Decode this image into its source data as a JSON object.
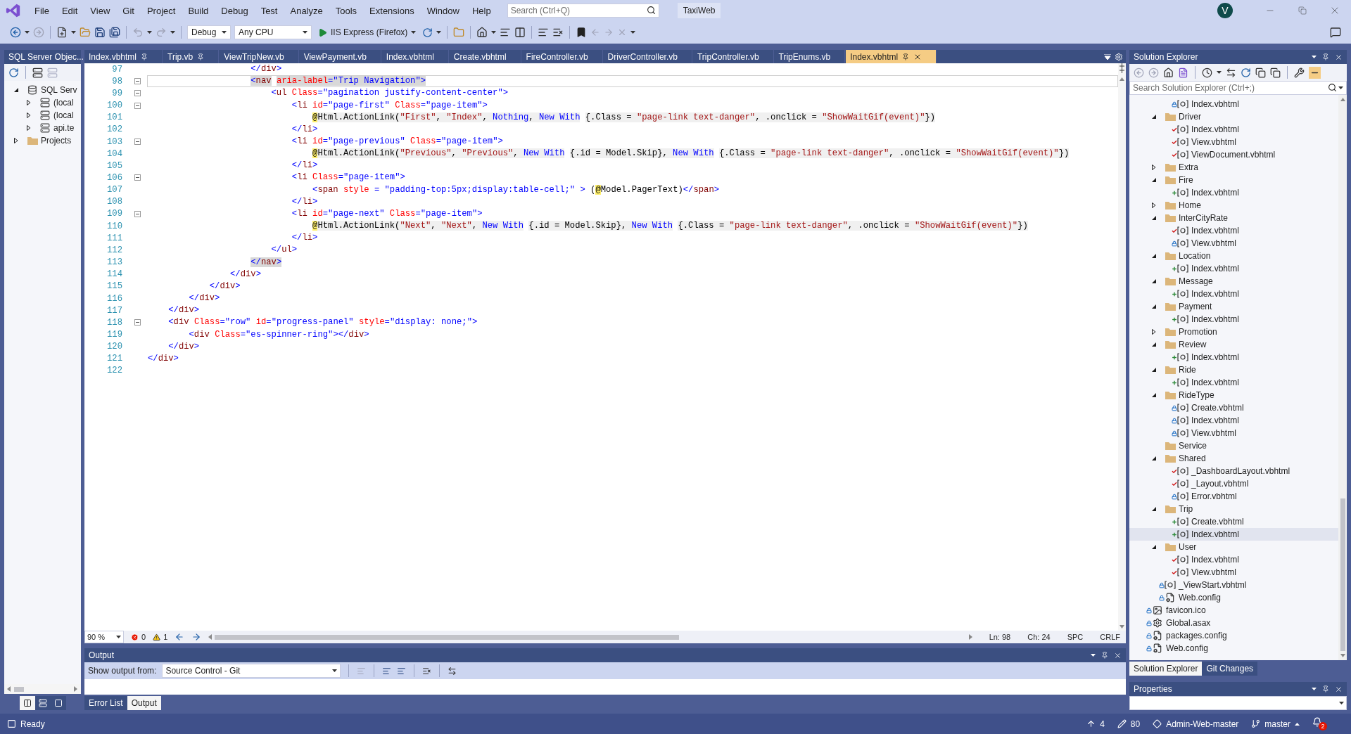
{
  "menu": [
    "File",
    "Edit",
    "View",
    "Git",
    "Project",
    "Build",
    "Debug",
    "Test",
    "Analyze",
    "Tools",
    "Extensions",
    "Window",
    "Help"
  ],
  "search": {
    "placeholder": "Search (Ctrl+Q)"
  },
  "solution_name": "TaxiWeb",
  "account": {
    "initial": "V"
  },
  "toolbar": {
    "configuration": "Debug",
    "platform": "Any CPU",
    "run_target": "IIS Express (Firefox)"
  },
  "sql_explorer": {
    "title": "SQL Server Objec...",
    "tree": [
      {
        "label": "SQL Serv",
        "kind": "server-group",
        "expanded": true,
        "children": [
          {
            "label": "(local",
            "kind": "server",
            "expanded": false
          },
          {
            "label": "(local",
            "kind": "server",
            "expanded": false
          },
          {
            "label": "api.te",
            "kind": "server",
            "expanded": false
          }
        ]
      },
      {
        "label": "Projects",
        "kind": "folder",
        "expanded": false
      }
    ],
    "view_buttons": [
      {
        "selected": true
      },
      {
        "selected": false
      },
      {
        "selected": false
      }
    ]
  },
  "editor": {
    "tabs": [
      {
        "label": "Index.vbhtml",
        "pinned": true,
        "selected": false
      },
      {
        "label": "Trip.vb",
        "pinned": true,
        "selected": false
      },
      {
        "label": "ViewTripNew.vb",
        "pinned": false,
        "selected": false
      },
      {
        "label": "ViewPayment.vb",
        "pinned": false,
        "selected": false
      },
      {
        "label": "Index.vbhtml",
        "pinned": false,
        "selected": false
      },
      {
        "label": "Create.vbhtml",
        "pinned": false,
        "selected": false
      },
      {
        "label": "FireController.vb",
        "pinned": false,
        "selected": false
      },
      {
        "label": "DriverController.vb",
        "pinned": false,
        "selected": false
      },
      {
        "label": "TripController.vb",
        "pinned": false,
        "selected": false
      },
      {
        "label": "TripEnums.vb",
        "pinned": false,
        "selected": false
      },
      {
        "label": "Index.vbhtml",
        "pinned": true,
        "selected": true
      }
    ],
    "lines": [
      {
        "number": "97",
        "kind": "markup",
        "current": false,
        "match": false,
        "foldable": false,
        "tokens": [
          {
            "kind": "delim",
            "text": "                    </"
          },
          {
            "kind": "tag",
            "text": "div"
          },
          {
            "kind": "delim",
            "text": ">"
          }
        ]
      },
      {
        "number": "98",
        "kind": "markup",
        "current": true,
        "match": true,
        "foldable": true,
        "tokens": [
          {
            "kind": "delim",
            "text": "                    <"
          },
          {
            "kind": "tag",
            "text": "nav"
          },
          {
            "kind": "attr",
            "text": " aria-label"
          },
          {
            "kind": "delim",
            "text": "="
          },
          {
            "kind": "value",
            "text": "\"Trip Navigation\""
          },
          {
            "kind": "delim",
            "text": ">"
          }
        ]
      },
      {
        "number": "99",
        "kind": "markup",
        "current": false,
        "match": false,
        "foldable": true,
        "tokens": [
          {
            "kind": "delim",
            "text": "                        <"
          },
          {
            "kind": "tag",
            "text": "ul"
          },
          {
            "kind": "attr",
            "text": " Class"
          },
          {
            "kind": "delim",
            "text": "="
          },
          {
            "kind": "value",
            "text": "\"pagination justify-content-center\""
          },
          {
            "kind": "delim",
            "text": ">"
          }
        ]
      },
      {
        "number": "100",
        "kind": "markup",
        "current": false,
        "match": false,
        "foldable": true,
        "tokens": [
          {
            "kind": "delim",
            "text": "                            <"
          },
          {
            "kind": "tag",
            "text": "li"
          },
          {
            "kind": "attr",
            "text": " id"
          },
          {
            "kind": "delim",
            "text": "="
          },
          {
            "kind": "value",
            "text": "\"page-first\""
          },
          {
            "kind": "attr",
            "text": " Class"
          },
          {
            "kind": "delim",
            "text": "="
          },
          {
            "kind": "value",
            "text": "\"page-item\""
          },
          {
            "kind": "delim",
            "text": ">"
          }
        ]
      },
      {
        "number": "101",
        "kind": "razor",
        "current": false,
        "match": false,
        "foldable": false,
        "tokens": [
          {
            "kind": "at",
            "text": "                                @"
          },
          {
            "kind": "code",
            "text": "Html.ActionLink("
          },
          {
            "kind": "string",
            "text": "\"First\""
          },
          {
            "kind": "code",
            "text": ", "
          },
          {
            "kind": "string",
            "text": "\"Index\""
          },
          {
            "kind": "code",
            "text": ", "
          },
          {
            "kind": "keyword",
            "text": "Nothing"
          },
          {
            "kind": "code",
            "text": ", "
          },
          {
            "kind": "keyword",
            "text": "New With"
          },
          {
            "kind": "code",
            "text": " {.Class = "
          },
          {
            "kind": "string",
            "text": "\"page-link text-danger\""
          },
          {
            "kind": "code",
            "text": ", .onclick = "
          },
          {
            "kind": "string",
            "text": "\"ShowWaitGif(event)\""
          },
          {
            "kind": "code",
            "text": "})"
          }
        ]
      },
      {
        "number": "102",
        "kind": "markup",
        "current": false,
        "match": false,
        "foldable": false,
        "tokens": [
          {
            "kind": "delim",
            "text": "                            </"
          },
          {
            "kind": "tag",
            "text": "li"
          },
          {
            "kind": "delim",
            "text": ">"
          }
        ]
      },
      {
        "number": "103",
        "kind": "markup",
        "current": false,
        "match": false,
        "foldable": true,
        "tokens": [
          {
            "kind": "delim",
            "text": "                            <"
          },
          {
            "kind": "tag",
            "text": "li"
          },
          {
            "kind": "attr",
            "text": " id"
          },
          {
            "kind": "delim",
            "text": "="
          },
          {
            "kind": "value",
            "text": "\"page-previous\""
          },
          {
            "kind": "attr",
            "text": " Class"
          },
          {
            "kind": "delim",
            "text": "="
          },
          {
            "kind": "value",
            "text": "\"page-item\""
          },
          {
            "kind": "delim",
            "text": ">"
          }
        ]
      },
      {
        "number": "104",
        "kind": "razor",
        "current": false,
        "match": false,
        "foldable": false,
        "tokens": [
          {
            "kind": "at",
            "text": "                                @"
          },
          {
            "kind": "code",
            "text": "Html.ActionLink("
          },
          {
            "kind": "string",
            "text": "\"Previous\""
          },
          {
            "kind": "code",
            "text": ", "
          },
          {
            "kind": "string",
            "text": "\"Previous\""
          },
          {
            "kind": "code",
            "text": ", "
          },
          {
            "kind": "keyword",
            "text": "New With"
          },
          {
            "kind": "code",
            "text": " {.id = Model.Skip}, "
          },
          {
            "kind": "keyword",
            "text": "New With"
          },
          {
            "kind": "code",
            "text": " {.Class = "
          },
          {
            "kind": "string",
            "text": "\"page-link text-danger\""
          },
          {
            "kind": "code",
            "text": ", .onclick = "
          },
          {
            "kind": "string",
            "text": "\"ShowWaitGif(event)\""
          },
          {
            "kind": "code",
            "text": "})"
          }
        ]
      },
      {
        "number": "105",
        "kind": "markup",
        "current": false,
        "match": false,
        "foldable": false,
        "tokens": [
          {
            "kind": "delim",
            "text": "                            </"
          },
          {
            "kind": "tag",
            "text": "li"
          },
          {
            "kind": "delim",
            "text": ">"
          }
        ]
      },
      {
        "number": "106",
        "kind": "markup",
        "current": false,
        "match": false,
        "foldable": true,
        "tokens": [
          {
            "kind": "delim",
            "text": "                            <"
          },
          {
            "kind": "tag",
            "text": "li"
          },
          {
            "kind": "attr",
            "text": " Class"
          },
          {
            "kind": "delim",
            "text": "="
          },
          {
            "kind": "value",
            "text": "\"page-item\""
          },
          {
            "kind": "delim",
            "text": ">"
          }
        ]
      },
      {
        "number": "107",
        "kind": "markup",
        "current": false,
        "match": false,
        "foldable": false,
        "tokens": [
          {
            "kind": "delim",
            "text": "                                <"
          },
          {
            "kind": "tag",
            "text": "span"
          },
          {
            "kind": "attr",
            "text": " style"
          },
          {
            "kind": "delim",
            "text": " = "
          },
          {
            "kind": "value",
            "text": "\"padding-top:5px;display:table-cell;\""
          },
          {
            "kind": "delim",
            "text": " >"
          },
          {
            "kind": "text",
            "text": " ("
          },
          {
            "kind": "at",
            "text": "@"
          },
          {
            "kind": "text",
            "text": "Model.PagerText)"
          },
          {
            "kind": "delim",
            "text": "</"
          },
          {
            "kind": "tag",
            "text": "span"
          },
          {
            "kind": "delim",
            "text": ">"
          }
        ]
      },
      {
        "number": "108",
        "kind": "markup",
        "current": false,
        "match": false,
        "foldable": false,
        "tokens": [
          {
            "kind": "delim",
            "text": "                            </"
          },
          {
            "kind": "tag",
            "text": "li"
          },
          {
            "kind": "delim",
            "text": ">"
          }
        ]
      },
      {
        "number": "109",
        "kind": "markup",
        "current": false,
        "match": false,
        "foldable": true,
        "tokens": [
          {
            "kind": "delim",
            "text": "                            <"
          },
          {
            "kind": "tag",
            "text": "li"
          },
          {
            "kind": "attr",
            "text": " id"
          },
          {
            "kind": "delim",
            "text": "="
          },
          {
            "kind": "value",
            "text": "\"page-next\""
          },
          {
            "kind": "attr",
            "text": " Class"
          },
          {
            "kind": "delim",
            "text": "="
          },
          {
            "kind": "value",
            "text": "\"page-item\""
          },
          {
            "kind": "delim",
            "text": ">"
          }
        ]
      },
      {
        "number": "110",
        "kind": "razor",
        "current": false,
        "match": false,
        "foldable": false,
        "tokens": [
          {
            "kind": "at",
            "text": "                                @"
          },
          {
            "kind": "code",
            "text": "Html.ActionLink("
          },
          {
            "kind": "string",
            "text": "\"Next\""
          },
          {
            "kind": "code",
            "text": ", "
          },
          {
            "kind": "string",
            "text": "\"Next\""
          },
          {
            "kind": "code",
            "text": ", "
          },
          {
            "kind": "keyword",
            "text": "New With"
          },
          {
            "kind": "code",
            "text": " {.id = Model.Skip}, "
          },
          {
            "kind": "keyword",
            "text": "New With"
          },
          {
            "kind": "code",
            "text": " {.Class = "
          },
          {
            "kind": "string",
            "text": "\"page-link text-danger\""
          },
          {
            "kind": "code",
            "text": ", .onclick = "
          },
          {
            "kind": "string",
            "text": "\"ShowWaitGif(event)\""
          },
          {
            "kind": "code",
            "text": "})"
          }
        ]
      },
      {
        "number": "111",
        "kind": "markup",
        "current": false,
        "match": false,
        "foldable": false,
        "tokens": [
          {
            "kind": "delim",
            "text": "                            </"
          },
          {
            "kind": "tag",
            "text": "li"
          },
          {
            "kind": "delim",
            "text": ">"
          }
        ]
      },
      {
        "number": "112",
        "kind": "markup",
        "current": false,
        "match": false,
        "foldable": false,
        "tokens": [
          {
            "kind": "delim",
            "text": "                        </"
          },
          {
            "kind": "tag",
            "text": "ul"
          },
          {
            "kind": "delim",
            "text": ">"
          }
        ]
      },
      {
        "number": "113",
        "kind": "markup",
        "current": false,
        "match": true,
        "foldable": false,
        "tokens": [
          {
            "kind": "delim",
            "text": "                    </"
          },
          {
            "kind": "tag",
            "text": "nav"
          },
          {
            "kind": "delim",
            "text": ">"
          }
        ]
      },
      {
        "number": "114",
        "kind": "markup",
        "current": false,
        "match": false,
        "foldable": false,
        "tokens": [
          {
            "kind": "delim",
            "text": "                </"
          },
          {
            "kind": "tag",
            "text": "div"
          },
          {
            "kind": "delim",
            "text": ">"
          }
        ]
      },
      {
        "number": "115",
        "kind": "markup",
        "current": false,
        "match": false,
        "foldable": false,
        "tokens": [
          {
            "kind": "delim",
            "text": "            </"
          },
          {
            "kind": "tag",
            "text": "div"
          },
          {
            "kind": "delim",
            "text": ">"
          }
        ]
      },
      {
        "number": "116",
        "kind": "markup",
        "current": false,
        "match": false,
        "foldable": false,
        "tokens": [
          {
            "kind": "delim",
            "text": "        </"
          },
          {
            "kind": "tag",
            "text": "div"
          },
          {
            "kind": "delim",
            "text": ">"
          }
        ]
      },
      {
        "number": "117",
        "kind": "markup",
        "current": false,
        "match": false,
        "foldable": false,
        "tokens": [
          {
            "kind": "delim",
            "text": "    </"
          },
          {
            "kind": "tag",
            "text": "div"
          },
          {
            "kind": "delim",
            "text": ">"
          }
        ]
      },
      {
        "number": "118",
        "kind": "markup",
        "current": false,
        "match": false,
        "foldable": true,
        "tokens": [
          {
            "kind": "delim",
            "text": "    <"
          },
          {
            "kind": "tag",
            "text": "div"
          },
          {
            "kind": "attr",
            "text": " Class"
          },
          {
            "kind": "delim",
            "text": "="
          },
          {
            "kind": "value",
            "text": "\"row\""
          },
          {
            "kind": "attr",
            "text": " id"
          },
          {
            "kind": "delim",
            "text": "="
          },
          {
            "kind": "value",
            "text": "\"progress-panel\""
          },
          {
            "kind": "attr",
            "text": " style"
          },
          {
            "kind": "delim",
            "text": "="
          },
          {
            "kind": "value",
            "text": "\"display: none;\""
          },
          {
            "kind": "delim",
            "text": ">"
          }
        ]
      },
      {
        "number": "119",
        "kind": "markup",
        "current": false,
        "match": false,
        "foldable": false,
        "tokens": [
          {
            "kind": "delim",
            "text": "        <"
          },
          {
            "kind": "tag",
            "text": "div"
          },
          {
            "kind": "attr",
            "text": " Class"
          },
          {
            "kind": "delim",
            "text": "="
          },
          {
            "kind": "value",
            "text": "\"es-spinner-ring\""
          },
          {
            "kind": "delim",
            "text": "></"
          },
          {
            "kind": "tag",
            "text": "div"
          },
          {
            "kind": "delim",
            "text": ">"
          }
        ]
      },
      {
        "number": "120",
        "kind": "markup",
        "current": false,
        "match": false,
        "foldable": false,
        "tokens": [
          {
            "kind": "delim",
            "text": "    </"
          },
          {
            "kind": "tag",
            "text": "div"
          },
          {
            "kind": "delim",
            "text": ">"
          }
        ]
      },
      {
        "number": "121",
        "kind": "markup",
        "current": false,
        "match": false,
        "foldable": false,
        "tokens": [
          {
            "kind": "delim",
            "text": "</"
          },
          {
            "kind": "tag",
            "text": "div"
          },
          {
            "kind": "delim",
            "text": ">"
          }
        ]
      },
      {
        "number": "122",
        "kind": "blank"
      }
    ],
    "footer": {
      "zoom": "90 %",
      "errors": "0",
      "warnings": "1",
      "line": "Ln: 98",
      "column": "Ch: 24",
      "whitespace": "SPC",
      "line_endings": "CRLF"
    }
  },
  "output": {
    "title": "Output",
    "source_label": "Show output from:",
    "source": "Source Control - Git"
  },
  "bottom_tabs": [
    {
      "label": "Error List",
      "selected": false
    },
    {
      "label": "Output",
      "selected": true
    }
  ],
  "solution_explorer": {
    "title": "Solution Explorer",
    "search": {
      "placeholder": "Search Solution Explorer (Ctrl+;)"
    },
    "tree": [
      {
        "children": [
          {
            "children": [
              {
                "label": "Index.vbhtml",
                "kind": "razor",
                "vcs": {
                  "kind": "locked"
                },
                "selected": false
              }
            ]
          },
          {
            "label": "Driver",
            "kind": "folder",
            "expanded": true,
            "selected": false,
            "children": [
              {
                "label": "Index.vbhtml",
                "kind": "razor",
                "vcs": {
                  "kind": "modified"
                },
                "selected": false
              },
              {
                "label": "View.vbhtml",
                "kind": "razor",
                "vcs": {
                  "kind": "modified"
                },
                "selected": false
              },
              {
                "label": "ViewDocument.vbhtml",
                "kind": "razor",
                "vcs": {
                  "kind": "modified"
                },
                "selected": false
              }
            ]
          },
          {
            "label": "Extra",
            "kind": "folder",
            "expanded": false,
            "selected": false
          },
          {
            "label": "Fire",
            "kind": "folder",
            "expanded": true,
            "selected": false,
            "children": [
              {
                "label": "Index.vbhtml",
                "kind": "razor",
                "vcs": {
                  "kind": "added"
                },
                "selected": false
              }
            ]
          },
          {
            "label": "Home",
            "kind": "folder",
            "expanded": false,
            "selected": false
          },
          {
            "label": "InterCityRate",
            "kind": "folder",
            "expanded": true,
            "selected": false,
            "children": [
              {
                "label": "Index.vbhtml",
                "kind": "razor",
                "vcs": {
                  "kind": "modified"
                },
                "selected": false
              },
              {
                "label": "View.vbhtml",
                "kind": "razor",
                "vcs": {
                  "kind": "locked"
                },
                "selected": false
              }
            ]
          },
          {
            "label": "Location",
            "kind": "folder",
            "expanded": true,
            "selected": false,
            "children": [
              {
                "label": "Index.vbhtml",
                "kind": "razor",
                "vcs": {
                  "kind": "added"
                },
                "selected": false
              }
            ]
          },
          {
            "label": "Message",
            "kind": "folder",
            "expanded": true,
            "selected": false,
            "children": [
              {
                "label": "Index.vbhtml",
                "kind": "razor",
                "vcs": {
                  "kind": "added"
                },
                "selected": false
              }
            ]
          },
          {
            "label": "Payment",
            "kind": "folder",
            "expanded": true,
            "selected": false,
            "children": [
              {
                "label": "Index.vbhtml",
                "kind": "razor",
                "vcs": {
                  "kind": "added"
                },
                "selected": false
              }
            ]
          },
          {
            "label": "Promotion",
            "kind": "folder",
            "expanded": false,
            "selected": false
          },
          {
            "label": "Review",
            "kind": "folder",
            "expanded": true,
            "selected": false,
            "children": [
              {
                "label": "Index.vbhtml",
                "kind": "razor",
                "vcs": {
                  "kind": "added"
                },
                "selected": false
              }
            ]
          },
          {
            "label": "Ride",
            "kind": "folder",
            "expanded": true,
            "selected": false,
            "children": [
              {
                "label": "Index.vbhtml",
                "kind": "razor",
                "vcs": {
                  "kind": "added"
                },
                "selected": false
              }
            ]
          },
          {
            "label": "RideType",
            "kind": "folder",
            "expanded": true,
            "selected": false,
            "children": [
              {
                "label": "Create.vbhtml",
                "kind": "razor",
                "vcs": {
                  "kind": "locked"
                },
                "selected": false
              },
              {
                "label": "Index.vbhtml",
                "kind": "razor",
                "vcs": {
                  "kind": "locked"
                },
                "selected": false
              },
              {
                "label": "View.vbhtml",
                "kind": "razor",
                "vcs": {
                  "kind": "locked"
                },
                "selected": false
              }
            ]
          },
          {
            "label": "Service",
            "kind": "empty-folder",
            "selected": false
          },
          {
            "label": "Shared",
            "kind": "folder",
            "expanded": true,
            "selected": false,
            "children": [
              {
                "label": "_DashboardLayout.vbhtml",
                "kind": "razor",
                "vcs": {
                  "kind": "modified"
                },
                "selected": false
              },
              {
                "label": "_Layout.vbhtml",
                "kind": "razor",
                "vcs": {
                  "kind": "modified"
                },
                "selected": false
              },
              {
                "label": "Error.vbhtml",
                "kind": "razor",
                "vcs": {
                  "kind": "locked"
                },
                "selected": false
              }
            ]
          },
          {
            "label": "Trip",
            "kind": "folder",
            "expanded": true,
            "selected": false,
            "children": [
              {
                "label": "Create.vbhtml",
                "kind": "razor",
                "vcs": {
                  "kind": "added"
                },
                "selected": false
              },
              {
                "label": "Index.vbhtml",
                "kind": "razor",
                "vcs": {
                  "kind": "added"
                },
                "selected": true
              }
            ]
          },
          {
            "label": "User",
            "kind": "folder",
            "expanded": true,
            "selected": false,
            "children": [
              {
                "label": "Index.vbhtml",
                "kind": "razor",
                "vcs": {
                  "kind": "modified"
                },
                "selected": false
              },
              {
                "label": "View.vbhtml",
                "kind": "razor",
                "vcs": {
                  "kind": "modified"
                },
                "selected": false
              }
            ]
          },
          {
            "label": "_ViewStart.vbhtml",
            "kind": "razor",
            "vcs": {
              "kind": "locked"
            },
            "selected": false
          },
          {
            "label": "Web.config",
            "kind": "config",
            "vcs": {
              "kind": "locked"
            },
            "selected": false
          }
        ]
      },
      {
        "label": "favicon.ico",
        "kind": "image",
        "vcs": {
          "kind": "locked"
        },
        "selected": false
      },
      {
        "label": "Global.asax",
        "kind": "asax",
        "vcs": {
          "kind": "locked"
        },
        "selected": false
      },
      {
        "label": "packages.config",
        "kind": "config",
        "vcs": {
          "kind": "locked"
        },
        "selected": false
      },
      {
        "label": "Web.config",
        "kind": "config",
        "vcs": {
          "kind": "locked"
        },
        "selected": false
      }
    ],
    "tabs": [
      {
        "label": "Solution Explorer",
        "selected": true
      },
      {
        "label": "Git Changes",
        "selected": false
      }
    ]
  },
  "properties": {
    "title": "Properties"
  },
  "status_bar": {
    "message": "Ready",
    "unpushed": "4",
    "changes": "80",
    "repository": "Admin-Web-master",
    "branch": "master",
    "notifications": "2"
  }
}
